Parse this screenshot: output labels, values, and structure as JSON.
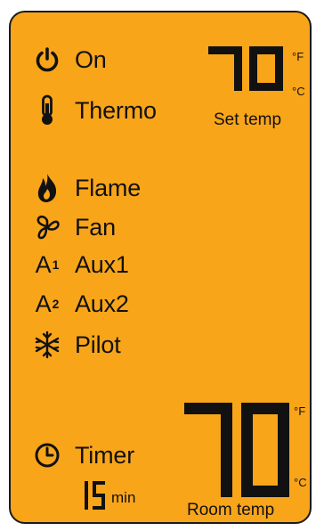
{
  "status_items": [
    {
      "name": "on",
      "icon": "power-icon",
      "label": "On"
    },
    {
      "name": "thermo",
      "icon": "thermometer-icon",
      "label": "Thermo"
    },
    {
      "name": "flame",
      "icon": "flame-icon",
      "label": "Flame"
    },
    {
      "name": "fan",
      "icon": "fan-icon",
      "label": "Fan"
    },
    {
      "name": "aux1",
      "icon": "aux1-icon",
      "label": "Aux1",
      "icon_glyph": "A",
      "icon_sup": "1"
    },
    {
      "name": "aux2",
      "icon": "aux2-icon",
      "label": "Aux2",
      "icon_glyph": "A",
      "icon_sup": "2"
    },
    {
      "name": "pilot",
      "icon": "snowflake-icon",
      "label": "Pilot"
    }
  ],
  "set_temp": {
    "value": "70",
    "unit_f": "°F",
    "unit_c": "°C",
    "caption": "Set temp"
  },
  "room_temp": {
    "value": "70",
    "unit_f": "°F",
    "unit_c": "°C",
    "caption": "Room temp"
  },
  "timer": {
    "label": "Timer",
    "icon": "clock-icon",
    "value": "15",
    "unit": "min"
  },
  "colors": {
    "panel": "#F9A51A",
    "ink": "#111111",
    "border": "#1a1a1a"
  }
}
